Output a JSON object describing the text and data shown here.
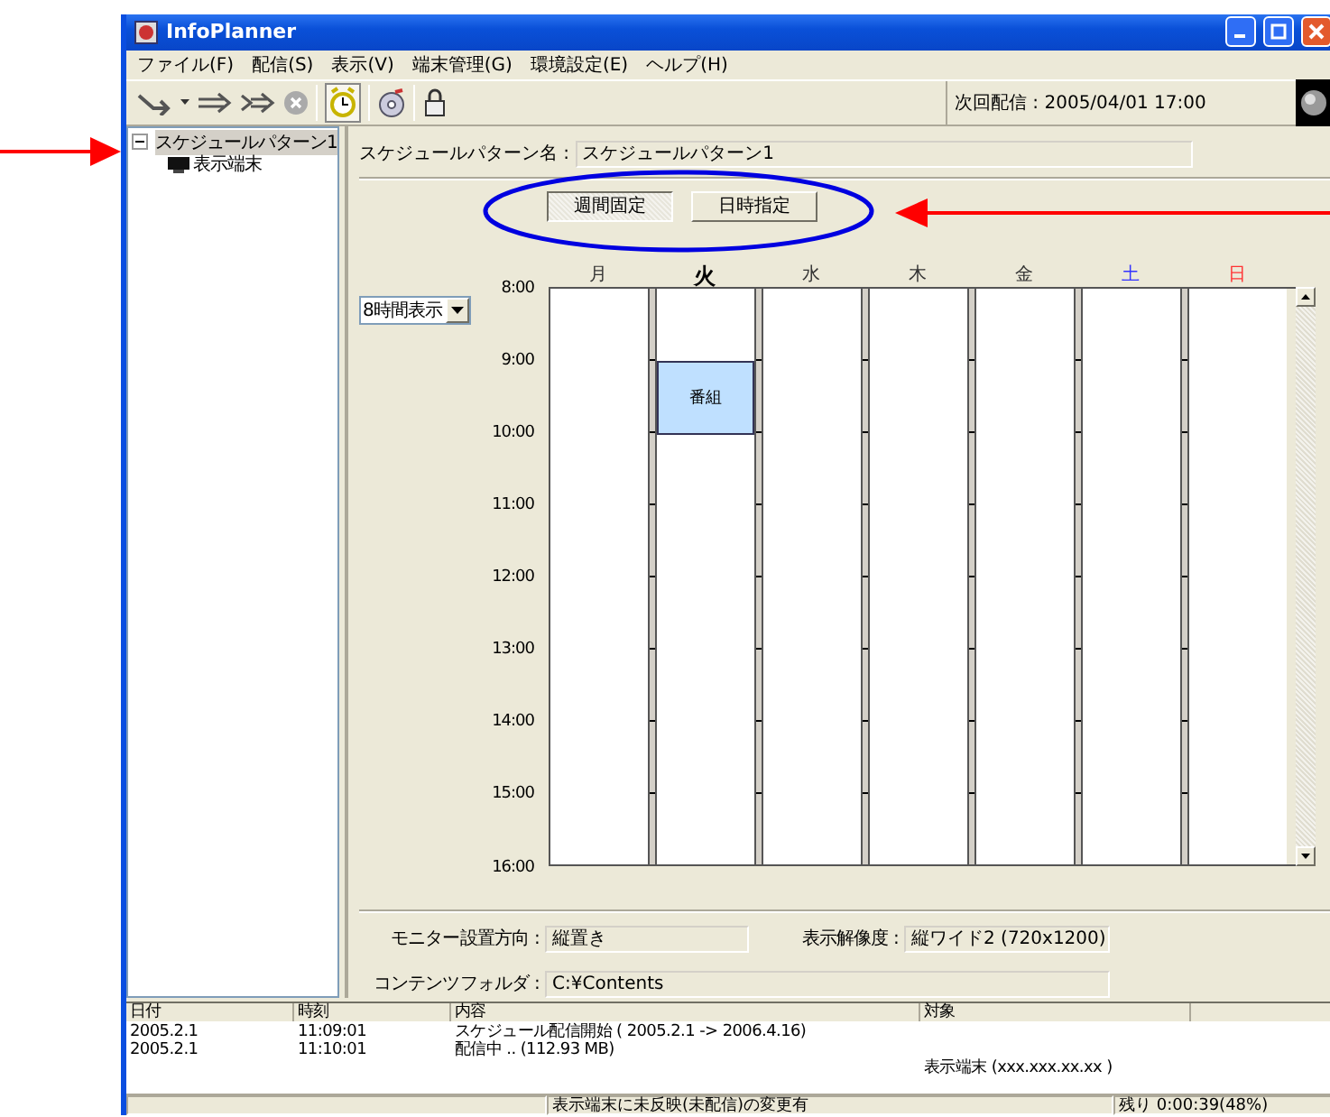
{
  "window": {
    "title": "InfoPlanner"
  },
  "menu": [
    "ファイル(F)",
    "配信(S)",
    "表示(V)",
    "端末管理(G)",
    "環境設定(E)",
    "ヘルプ(H)"
  ],
  "toolbar": {
    "next_delivery": "次回配信 : 2005/04/01 17:00",
    "alarm_pressed": true
  },
  "tree": [
    {
      "label": "スケジュールパターン1",
      "expanded": true,
      "selected": true,
      "children": [
        {
          "label": "表示端末",
          "selected": false
        }
      ]
    }
  ],
  "pattern": {
    "label": "スケジュールパターン名 :",
    "value": "スケジュールパターン1"
  },
  "modes": [
    {
      "label": "週間固定",
      "selected": true
    },
    {
      "label": "日時指定",
      "selected": false
    }
  ],
  "view_select": {
    "value": "8時間表示"
  },
  "days": [
    {
      "label": "月",
      "selected": false
    },
    {
      "label": "火",
      "selected": true,
      "slots": [
        {
          "filled": false
        },
        {
          "filled": true,
          "label": "番組"
        }
      ]
    },
    {
      "label": "水",
      "selected": false
    },
    {
      "label": "木",
      "selected": false
    },
    {
      "label": "金",
      "selected": false
    },
    {
      "label": "土",
      "selected": false,
      "color": "#3333ff"
    },
    {
      "label": "日",
      "selected": false,
      "color": "#ff3333"
    }
  ],
  "times": [
    "8:00",
    "9:00",
    "10:00",
    "11:00",
    "12:00",
    "13:00",
    "14:00",
    "15:00",
    "16:00"
  ],
  "settings": [
    {
      "label": "モニター設置方向 :",
      "value": "縦置き"
    },
    {
      "label": "表示解像度 :",
      "value": "縦ワイド2 (720x1200)"
    },
    {
      "label": "コンテンツフォルダ :",
      "value": "C:¥Contents"
    }
  ],
  "log": {
    "columns": [
      "日付",
      "時刻",
      "内容",
      "対象"
    ],
    "rows": [
      {
        "date": "2005.2.1",
        "time": "11:09:01",
        "content": "スケジュール配信開始 ( 2005.2.1 -> 2006.4.16)"
      },
      {
        "date": "2005.2.1",
        "time": "11:10:01",
        "content": "配信中 .. (112.93 MB)",
        "target": "表示端末 (xxx.xxx.xx.xx )"
      }
    ]
  },
  "status_bar": {
    "message": "表示端末に未反映(未配信)の変更有",
    "remaining": "残り 0:00:39(48%)"
  }
}
